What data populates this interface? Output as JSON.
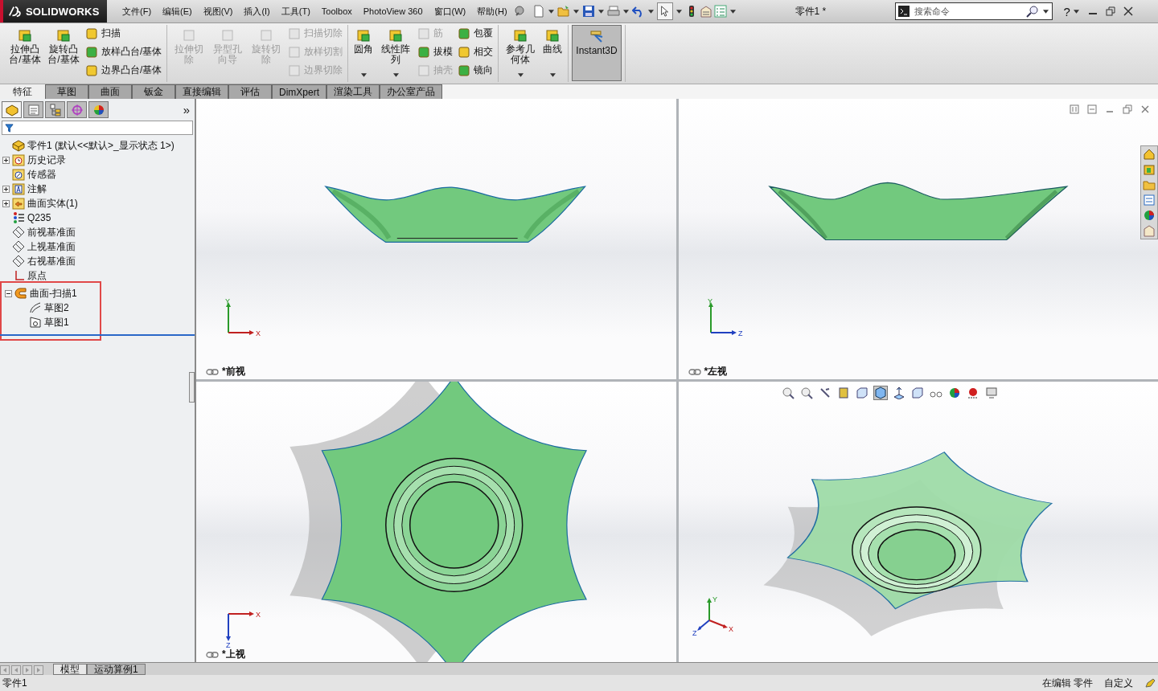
{
  "app": {
    "logo": "SOLIDWORKS",
    "menu": [
      "文件(F)",
      "编辑(E)",
      "视图(V)",
      "插入(I)",
      "工具(T)",
      "Toolbox",
      "PhotoView 360",
      "窗口(W)",
      "帮助(H)"
    ],
    "document_title": "零件1 *",
    "search": {
      "placeholder": "搜索命令"
    },
    "help": "?"
  },
  "ribbon": [
    {
      "commands": [
        {
          "label": "拉伸凸台/基体",
          "kind": "large",
          "disabled": false,
          "dropdown": false
        },
        {
          "label": "旋转凸台/基体",
          "kind": "large",
          "disabled": false,
          "dropdown": false
        },
        {
          "label": "扫描",
          "kind": "small",
          "disabled": false
        },
        {
          "label": "放样凸台/基体",
          "kind": "small",
          "disabled": false
        },
        {
          "label": "边界凸台/基体",
          "kind": "small",
          "disabled": false
        }
      ]
    },
    {
      "commands": [
        {
          "label": "拉伸切除",
          "kind": "large",
          "disabled": true,
          "dropdown": false
        },
        {
          "label": "异型孔向导",
          "kind": "large",
          "disabled": true,
          "dropdown": false
        },
        {
          "label": "旋转切除",
          "kind": "large",
          "disabled": true,
          "dropdown": false
        },
        {
          "label": "扫描切除",
          "kind": "small",
          "disabled": true
        },
        {
          "label": "放样切割",
          "kind": "small",
          "disabled": true
        },
        {
          "label": "边界切除",
          "kind": "small",
          "disabled": true
        }
      ]
    },
    {
      "commands": [
        {
          "label": "圆角",
          "kind": "large",
          "disabled": false,
          "dropdown": true
        },
        {
          "label": "线性阵列",
          "kind": "large",
          "disabled": false,
          "dropdown": true
        },
        {
          "label": "筋",
          "kind": "small",
          "disabled": true
        },
        {
          "label": "拔模",
          "kind": "small",
          "disabled": false
        },
        {
          "label": "抽壳",
          "kind": "small",
          "disabled": true
        },
        {
          "label": "包覆",
          "kind": "small",
          "disabled": false
        },
        {
          "label": "相交",
          "kind": "small",
          "disabled": false
        },
        {
          "label": "镜向",
          "kind": "small",
          "disabled": false
        }
      ]
    },
    {
      "commands": [
        {
          "label": "参考几何体",
          "kind": "large",
          "disabled": false,
          "dropdown": true
        },
        {
          "label": "曲线",
          "kind": "large",
          "disabled": false,
          "dropdown": true
        }
      ]
    },
    {
      "commands": [
        {
          "label": "Instant3D",
          "kind": "large",
          "disabled": false,
          "dropdown": false,
          "on": true
        }
      ]
    }
  ],
  "tabs": [
    {
      "label": "特征",
      "selected": true
    },
    {
      "label": "草图",
      "selected": false
    },
    {
      "label": "曲面",
      "selected": false
    },
    {
      "label": "钣金",
      "selected": false
    },
    {
      "label": "直接编辑",
      "selected": false
    },
    {
      "label": "评估",
      "selected": false
    },
    {
      "label": "DimXpert",
      "selected": false
    },
    {
      "label": "渲染工具",
      "selected": false
    },
    {
      "label": "办公室产品",
      "selected": false
    }
  ],
  "panel": {
    "panel_tabs": [
      {
        "selected": true
      },
      {
        "selected": false
      },
      {
        "selected": false
      },
      {
        "selected": false
      },
      {
        "selected": false
      }
    ],
    "more": "»",
    "tree": {
      "label": "零件1  (默认<<默认>_显示状态 1>)",
      "kind": "part",
      "children": [
        {
          "label": "历史记录",
          "kind": "history",
          "expanded": false,
          "highlighted": false
        },
        {
          "label": "传感器",
          "kind": "sensor",
          "highlighted": false
        },
        {
          "label": "注解",
          "kind": "annotation",
          "expanded": false,
          "highlighted": false
        },
        {
          "label": "曲面实体(1)",
          "kind": "surface-folder",
          "expanded": false,
          "highlighted": false
        },
        {
          "label": "Q235",
          "kind": "material",
          "highlighted": false
        },
        {
          "label": "前视基准面",
          "kind": "plane",
          "highlighted": false
        },
        {
          "label": "上视基准面",
          "kind": "plane",
          "highlighted": false
        },
        {
          "label": "右视基准面",
          "kind": "plane",
          "highlighted": false
        },
        {
          "label": "原点",
          "kind": "origin",
          "highlighted": false
        },
        {
          "label": "曲面-扫描1",
          "kind": "sweep",
          "expanded": true,
          "highlighted": true,
          "children": [
            {
              "label": "草图2",
              "kind": "sketch-path"
            },
            {
              "label": "草图1",
              "kind": "sketch-profile"
            }
          ]
        }
      ]
    }
  },
  "viewports": [
    {
      "kind": "front",
      "label": "*前视",
      "axes": [
        "Y",
        "X"
      ]
    },
    {
      "kind": "left",
      "label": "*左视",
      "axes": [
        "Y",
        "Z"
      ]
    },
    {
      "kind": "top",
      "label": "*上视",
      "axes": [
        "X",
        "Z"
      ]
    },
    {
      "kind": "iso",
      "axes": [
        "Y",
        "X",
        "Z"
      ]
    }
  ],
  "bottom_tabs": [
    {
      "label": "模型",
      "selected": true
    },
    {
      "label": "运动算例1",
      "selected": false
    }
  ],
  "status_bar": {
    "left": "零件1",
    "right": [
      "在编辑 零件",
      "自定义"
    ]
  }
}
